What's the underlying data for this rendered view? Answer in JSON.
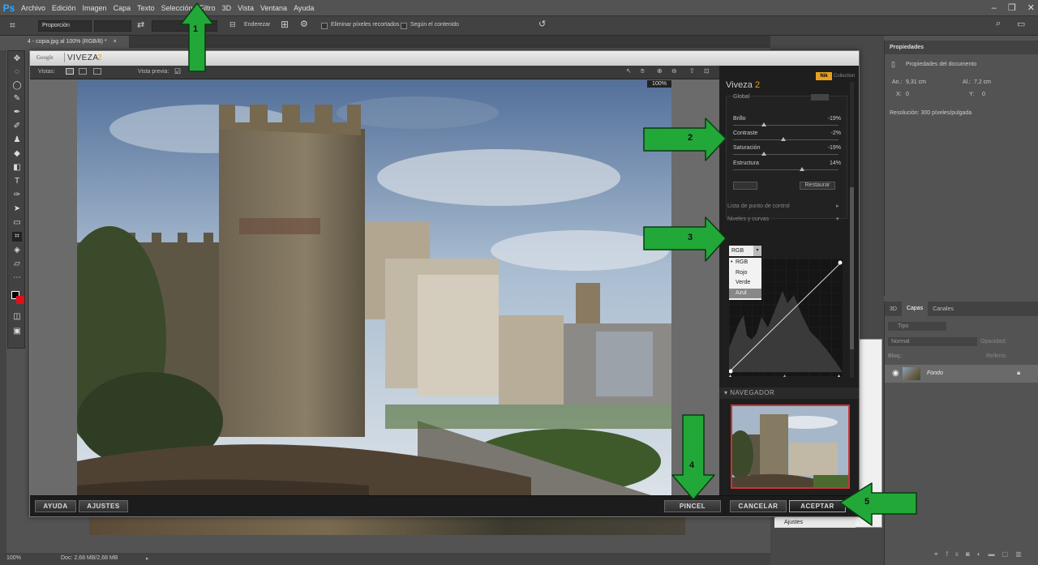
{
  "menubar": {
    "logo": "Ps",
    "items": [
      "Archivo",
      "Edición",
      "Imagen",
      "Capa",
      "Texto",
      "Selección",
      "Filtro",
      "3D",
      "Vista",
      "Ventana",
      "Ayuda"
    ]
  },
  "options": {
    "ratio_value": "Proporción",
    "straighten_label": "Enderezar",
    "delete_pixels_label": "Eliminar píxeles recortados",
    "content_aware_label": "Según el contenido"
  },
  "document_tab": {
    "label": "4 - copia.jpg al 100% (RGB/8) *",
    "close": "×"
  },
  "status": {
    "zoom": "100%",
    "doc_size": "Doc: 2,68 MB/2,68 MB"
  },
  "properties": {
    "title": "Propiedades",
    "subtitle": "Propiedades del documento",
    "an_label": "An.:",
    "an_value": "9,31 cm",
    "al_label": "Al.:",
    "al_value": "7,2 cm",
    "x_label": "X:",
    "x_value": "0",
    "y_label": "Y:",
    "y_value": "0",
    "resolution": "Resolución: 300 píxeles/pulgada"
  },
  "layers": {
    "tabs": [
      "3D",
      "Capas",
      "Canales"
    ],
    "active_tab": "Capas",
    "kind_label": "Tipo",
    "blend_mode": "Normal",
    "opacity_label": "Opacidad:",
    "lock_label": "Bloq.:",
    "fill_label": "Relleno:",
    "layer_name": "Fondo"
  },
  "viveza": {
    "brand_google": "Google",
    "brand_name": "VIVEZA",
    "brand_version": "2",
    "views_label": "Vistas:",
    "preview_label": "Vista previa:",
    "zoom_label": "100%",
    "panel_title": "Viveza",
    "panel_version": "2",
    "nik_badge": "Nik",
    "nik_collection": "Collection",
    "global_label": "Global",
    "adjustments": [
      {
        "label": "Brillo",
        "value": "-19%",
        "level": -0.19
      },
      {
        "label": "Contraste",
        "value": "-2%",
        "level": -0.02
      },
      {
        "label": "Saturación",
        "value": "-19%",
        "level": -0.19
      },
      {
        "label": "Estructura",
        "value": "14%",
        "level": 0.14
      }
    ],
    "restore_button": "Restaurar",
    "control_points_list": "Lista de punto de control",
    "levels_curves": "Niveles y curvas",
    "channel_selected": "RGB",
    "channel_options": [
      "RGB",
      "Rojo",
      "Verde",
      "Azul"
    ],
    "navigator_label": "NAVEGADOR",
    "buttons": {
      "help": "AYUDA",
      "settings": "AJUSTES",
      "brush": "PINCEL",
      "cancel": "CANCELAR",
      "accept": "ACEPTAR"
    }
  },
  "annotations": [
    "1",
    "2",
    "3",
    "4",
    "5"
  ],
  "small_dialog": {
    "tab_label": "Ajustes"
  },
  "colors": {
    "arrow_green": "#22a838",
    "ps_blue": "#31a8ff",
    "panel_dark": "#535353",
    "viveza_dark": "#1e1e1e",
    "viveza_orange": "#e8a020"
  }
}
